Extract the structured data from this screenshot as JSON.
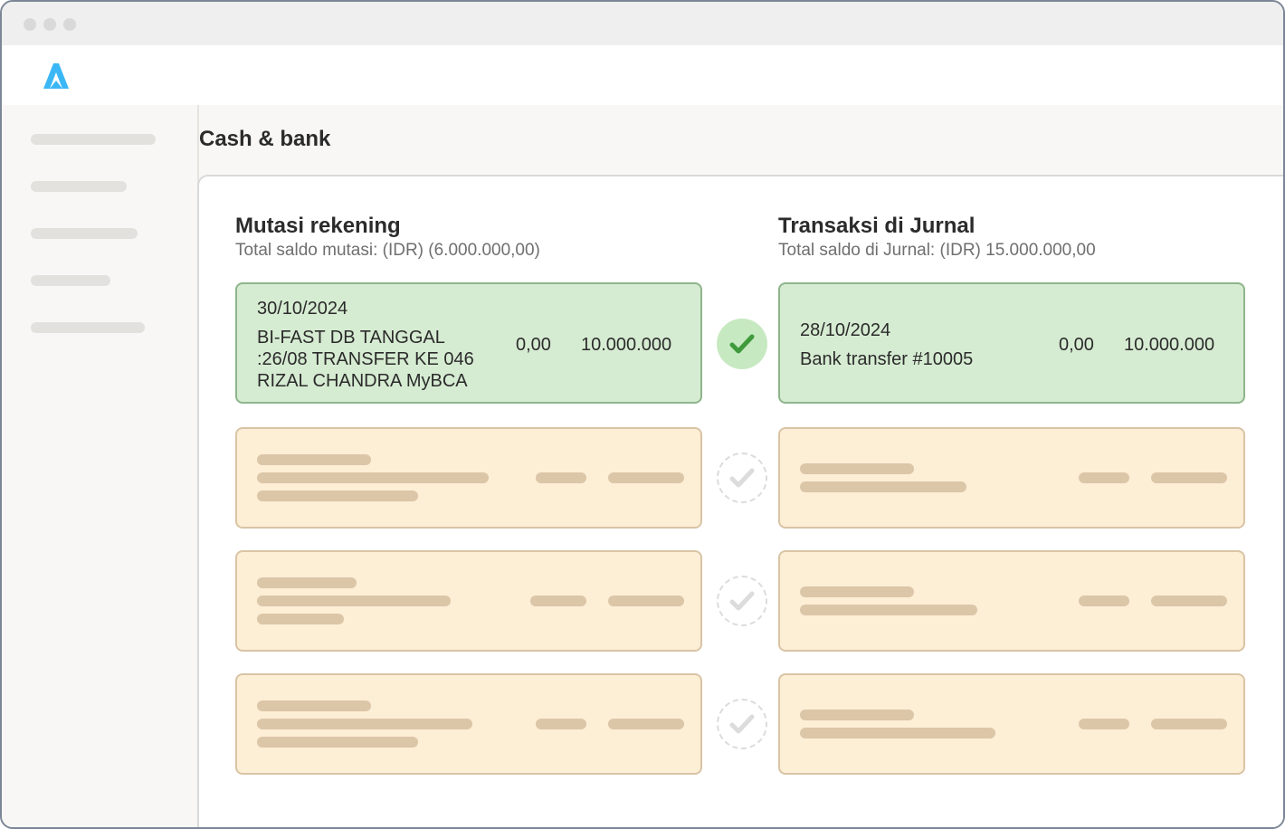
{
  "app": {
    "page_title": "Cash & bank",
    "brand_color": "#3bb7f5",
    "logo_icon": "brand-logo-icon"
  },
  "sidebar": {
    "items": [
      {
        "placeholder": true
      },
      {
        "placeholder": true
      },
      {
        "placeholder": true
      },
      {
        "placeholder": true
      },
      {
        "placeholder": true
      }
    ]
  },
  "reconciliation": {
    "left": {
      "title": "Mutasi rekening",
      "subtitle": "Total saldo mutasi: (IDR) (6.000.000,00)",
      "matched": {
        "date": "30/10/2024",
        "description_lines": [
          "BI-FAST DB TANGGAL",
          ":26/08 TRANSFER KE 046",
          "RIZAL CHANDRA MyBCA"
        ],
        "debit": "0,00",
        "credit": "10.000.000"
      }
    },
    "right": {
      "title": "Transaksi di Jurnal",
      "subtitle": "Total saldo di Jurnal: (IDR) 15.000.000,00",
      "matched": {
        "date": "28/10/2024",
        "description": "Bank transfer #10005",
        "debit": "0,00",
        "credit": "10.000.000"
      }
    },
    "match_states": [
      "matched",
      "unmatched",
      "unmatched",
      "unmatched"
    ],
    "colors": {
      "matched_card": "#d6ecd2",
      "pending_card": "#fdeed6",
      "check_green": "#3f9a3c",
      "check_grey": "#dcdcdc"
    }
  }
}
